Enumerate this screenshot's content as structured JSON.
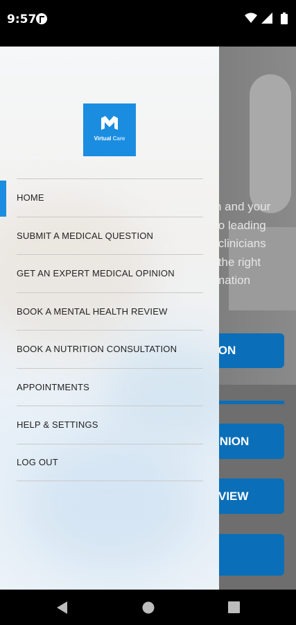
{
  "status": {
    "time": "9:57"
  },
  "drawer": {
    "logo": {
      "word1": "Virtual",
      "word2": "Care"
    },
    "menu": [
      {
        "label": "HOME"
      },
      {
        "label": "SUBMIT A MEDICAL QUESTION"
      },
      {
        "label": "GET AN EXPERT MEDICAL OPINION"
      },
      {
        "label": "BOOK A MENTAL HEALTH REVIEW"
      },
      {
        "label": "BOOK A NUTRITION CONSULTATION"
      },
      {
        "label": "APPOINTMENTS"
      },
      {
        "label": "HELP & SETTINGS"
      },
      {
        "label": "LOG OUT"
      }
    ]
  },
  "background": {
    "text_lines": "h and your\n o leading\n clinicians\n the right\nmation",
    "button1": "ION",
    "button2": "INION",
    "button3": "VIEW"
  },
  "colors": {
    "accent": "#1b8de0",
    "button": "#0a6fb8"
  }
}
